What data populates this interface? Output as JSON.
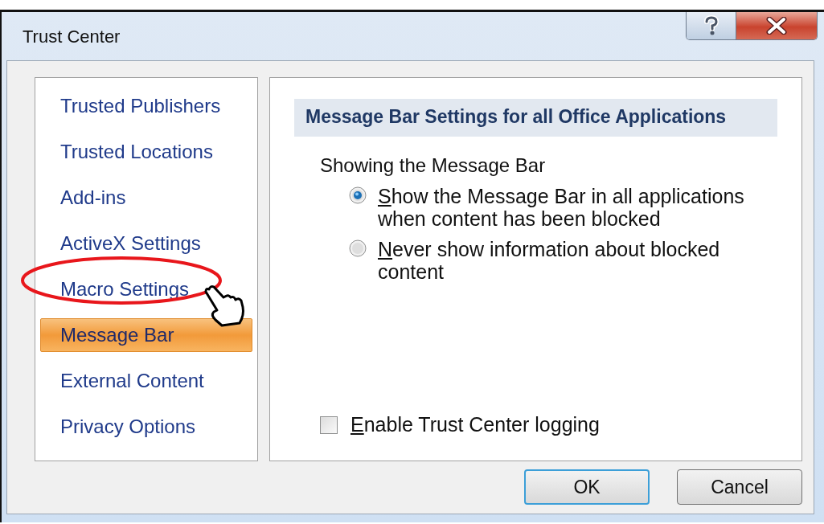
{
  "window": {
    "title": "Trust Center"
  },
  "sidebar": {
    "items": [
      {
        "label": "Trusted Publishers",
        "selected": false
      },
      {
        "label": "Trusted Locations",
        "selected": false
      },
      {
        "label": "Add-ins",
        "selected": false
      },
      {
        "label": "ActiveX Settings",
        "selected": false
      },
      {
        "label": "Macro Settings",
        "selected": false
      },
      {
        "label": "Message Bar",
        "selected": true
      },
      {
        "label": "External Content",
        "selected": false
      },
      {
        "label": "Privacy Options",
        "selected": false
      }
    ]
  },
  "content": {
    "heading": "Message Bar Settings for all Office Applications",
    "group_label": "Showing the Message Bar",
    "options": [
      {
        "label": "Show the Message Bar in all applications when content has been blocked",
        "selected": true
      },
      {
        "label": "Never show information about blocked content",
        "selected": false
      }
    ],
    "logging": {
      "label": "Enable Trust Center logging",
      "checked": false
    }
  },
  "buttons": [
    {
      "label": "OK",
      "default": true
    },
    {
      "label": "Cancel",
      "default": false
    }
  ]
}
